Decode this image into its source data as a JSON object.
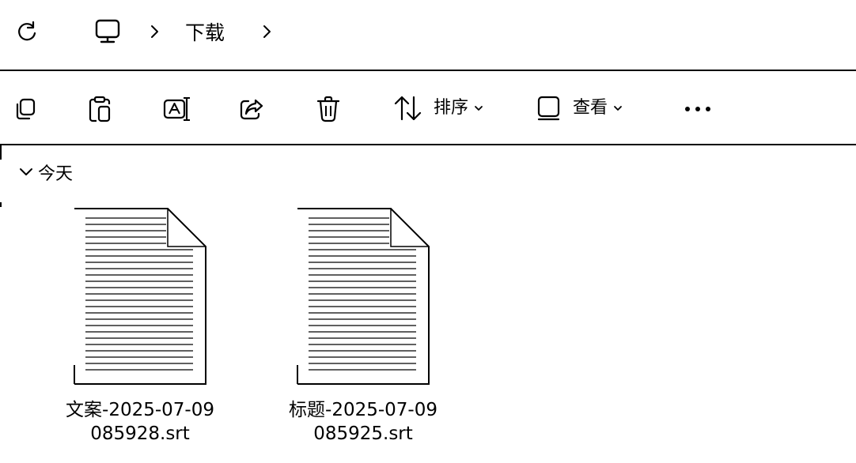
{
  "address_bar": {
    "refresh_icon": "refresh-icon",
    "root_icon": "this-pc-icon",
    "crumbs": [
      {
        "label": "下载"
      }
    ]
  },
  "command_bar": {
    "sort_label": "排序",
    "view_label": "查看"
  },
  "group": {
    "label": "今天"
  },
  "files": [
    {
      "name_line1": "文案-2025-07-09",
      "name_line2": "085928.srt"
    },
    {
      "name_line1": "标题-2025-07-09",
      "name_line2": "085925.srt"
    }
  ],
  "colors": {
    "stroke": "#000000",
    "background": "#ffffff"
  }
}
